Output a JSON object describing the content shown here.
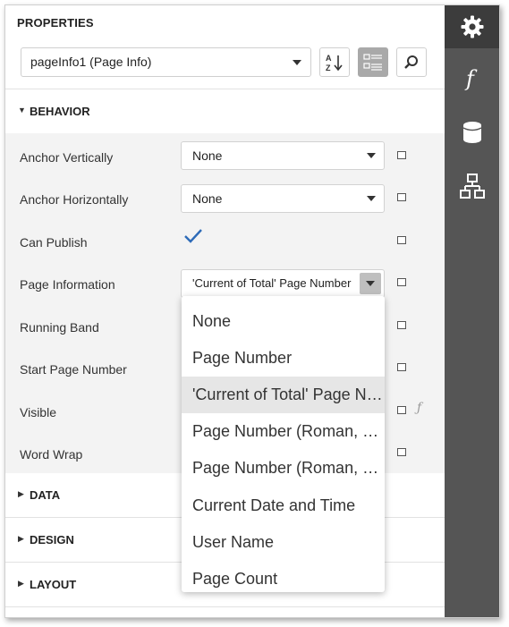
{
  "panel": {
    "title": "PROPERTIES",
    "object_selector": {
      "value": "pageInfo1 (Page Info)"
    },
    "toolbar": {
      "sort_alpha_icon": "sort-az-icon",
      "categorized_icon": "categorized-view-icon",
      "search_icon": "search-icon"
    }
  },
  "sections": {
    "behavior": "BEHAVIOR",
    "data": "DATA",
    "design": "DESIGN",
    "layout": "LAYOUT"
  },
  "properties": [
    {
      "label": "Anchor Vertically",
      "value": "None",
      "editor": "dropdown"
    },
    {
      "label": "Anchor Horizontally",
      "value": "None",
      "editor": "dropdown"
    },
    {
      "label": "Can Publish",
      "value": "checked",
      "editor": "checkbox"
    },
    {
      "label": "Page Information",
      "value": "'Current of Total' Page Number",
      "editor": "dropdown-open"
    },
    {
      "label": "Running Band",
      "value": "",
      "editor": "none"
    },
    {
      "label": "Start Page Number",
      "value": "",
      "editor": "none"
    },
    {
      "label": "Visible",
      "value": "",
      "editor": "none"
    },
    {
      "label": "Word Wrap",
      "value": "",
      "editor": "none"
    }
  ],
  "dropdown": {
    "options": [
      "None",
      "Page Number",
      "'Current of Total' Page Number",
      "Page Number (Roman, Lowercase)",
      "Page Number (Roman, Uppercase)",
      "Current Date and Time",
      "User Name",
      "Page Count"
    ],
    "selected_index": 2
  },
  "right_tabs": [
    {
      "icon": "gear-icon",
      "active": true
    },
    {
      "icon": "function-icon",
      "active": false
    },
    {
      "icon": "database-icon",
      "active": false
    },
    {
      "icon": "report-tree-icon",
      "active": false
    }
  ],
  "colors": {
    "side_bar": "#555555",
    "side_bar_active": "#3c3c3c",
    "checkmark": "#2e6bb8",
    "selected_option": "#e6e6e6"
  }
}
